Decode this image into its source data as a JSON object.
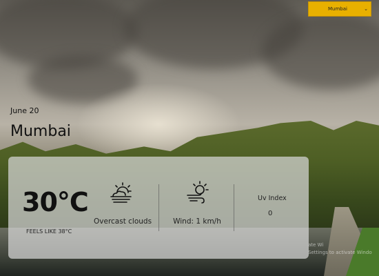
{
  "city_selector": {
    "selected": "Mumbai"
  },
  "location": {
    "date": "June 20",
    "city": "Mumbai"
  },
  "weather": {
    "temperature": "30°C",
    "feels_like": "FEELS LIKE 38°C",
    "condition": {
      "label": "Overcast clouds",
      "icon": "overcast-clouds-icon"
    },
    "wind": {
      "label": "Wind: 1 km/h",
      "icon": "wind-sun-icon"
    },
    "uv": {
      "title": "Uv Index",
      "value": "0"
    }
  },
  "watermark": {
    "line1": "ate Wi",
    "line2": "Settings to activate Windo"
  }
}
